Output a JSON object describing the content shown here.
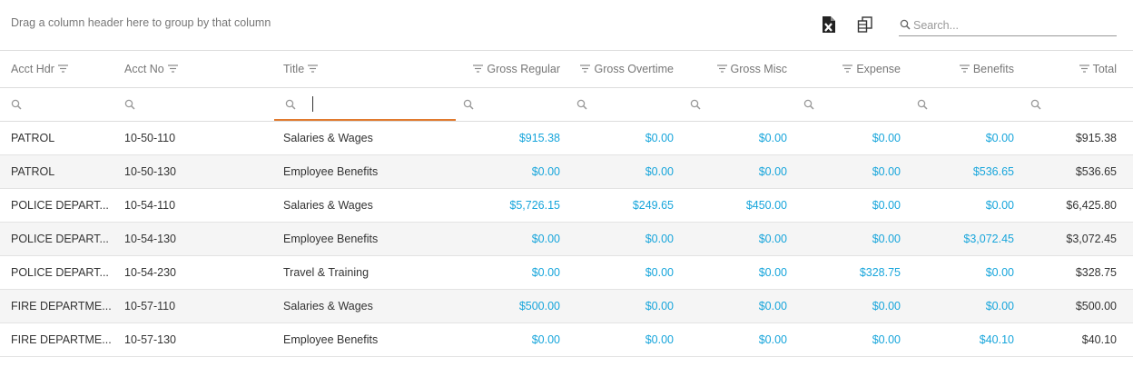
{
  "toolbar": {
    "group_panel_text": "Drag a column header here to group by that column",
    "search_placeholder": "Search..."
  },
  "columns": [
    {
      "key": "acct_hdr",
      "label": "Acct Hdr",
      "align": "left"
    },
    {
      "key": "acct_no",
      "label": "Acct No",
      "align": "left"
    },
    {
      "key": "title",
      "label": "Title",
      "align": "left"
    },
    {
      "key": "gross_regular",
      "label": "Gross Regular",
      "align": "right"
    },
    {
      "key": "gross_overtime",
      "label": "Gross Overtime",
      "align": "right"
    },
    {
      "key": "gross_misc",
      "label": "Gross Misc",
      "align": "right"
    },
    {
      "key": "expense",
      "label": "Expense",
      "align": "right"
    },
    {
      "key": "benefits",
      "label": "Benefits",
      "align": "right"
    },
    {
      "key": "total",
      "label": "Total",
      "align": "right"
    }
  ],
  "rows": [
    {
      "acct_hdr": "PATROL",
      "acct_no": "10-50-110",
      "title": "Salaries & Wages",
      "gross_regular": "$915.38",
      "gross_overtime": "$0.00",
      "gross_misc": "$0.00",
      "expense": "$0.00",
      "benefits": "$0.00",
      "total": "$915.38"
    },
    {
      "acct_hdr": "PATROL",
      "acct_no": "10-50-130",
      "title": "Employee Benefits",
      "gross_regular": "$0.00",
      "gross_overtime": "$0.00",
      "gross_misc": "$0.00",
      "expense": "$0.00",
      "benefits": "$536.65",
      "total": "$536.65"
    },
    {
      "acct_hdr": "POLICE DEPART...",
      "acct_no": "10-54-110",
      "title": "Salaries & Wages",
      "gross_regular": "$5,726.15",
      "gross_overtime": "$249.65",
      "gross_misc": "$450.00",
      "expense": "$0.00",
      "benefits": "$0.00",
      "total": "$6,425.80"
    },
    {
      "acct_hdr": "POLICE DEPART...",
      "acct_no": "10-54-130",
      "title": "Employee Benefits",
      "gross_regular": "$0.00",
      "gross_overtime": "$0.00",
      "gross_misc": "$0.00",
      "expense": "$0.00",
      "benefits": "$3,072.45",
      "total": "$3,072.45"
    },
    {
      "acct_hdr": "POLICE DEPART...",
      "acct_no": "10-54-230",
      "title": "Travel & Training",
      "gross_regular": "$0.00",
      "gross_overtime": "$0.00",
      "gross_misc": "$0.00",
      "expense": "$328.75",
      "benefits": "$0.00",
      "total": "$328.75"
    },
    {
      "acct_hdr": "FIRE DEPARTME...",
      "acct_no": "10-57-110",
      "title": "Salaries & Wages",
      "gross_regular": "$500.00",
      "gross_overtime": "$0.00",
      "gross_misc": "$0.00",
      "expense": "$0.00",
      "benefits": "$0.00",
      "total": "$500.00"
    },
    {
      "acct_hdr": "FIRE DEPARTME...",
      "acct_no": "10-57-130",
      "title": "Employee Benefits",
      "gross_regular": "$0.00",
      "gross_overtime": "$0.00",
      "gross_misc": "$0.00",
      "expense": "$0.00",
      "benefits": "$40.10",
      "total": "$40.10"
    }
  ],
  "colors": {
    "link": "#17a5db",
    "active_filter_underline": "#e17a2e",
    "alt_row": "#f5f5f5"
  },
  "icons": {
    "export": "excel-export-icon",
    "column_chooser": "column-chooser-icon",
    "search": "search-icon",
    "filter": "filter-icon"
  }
}
